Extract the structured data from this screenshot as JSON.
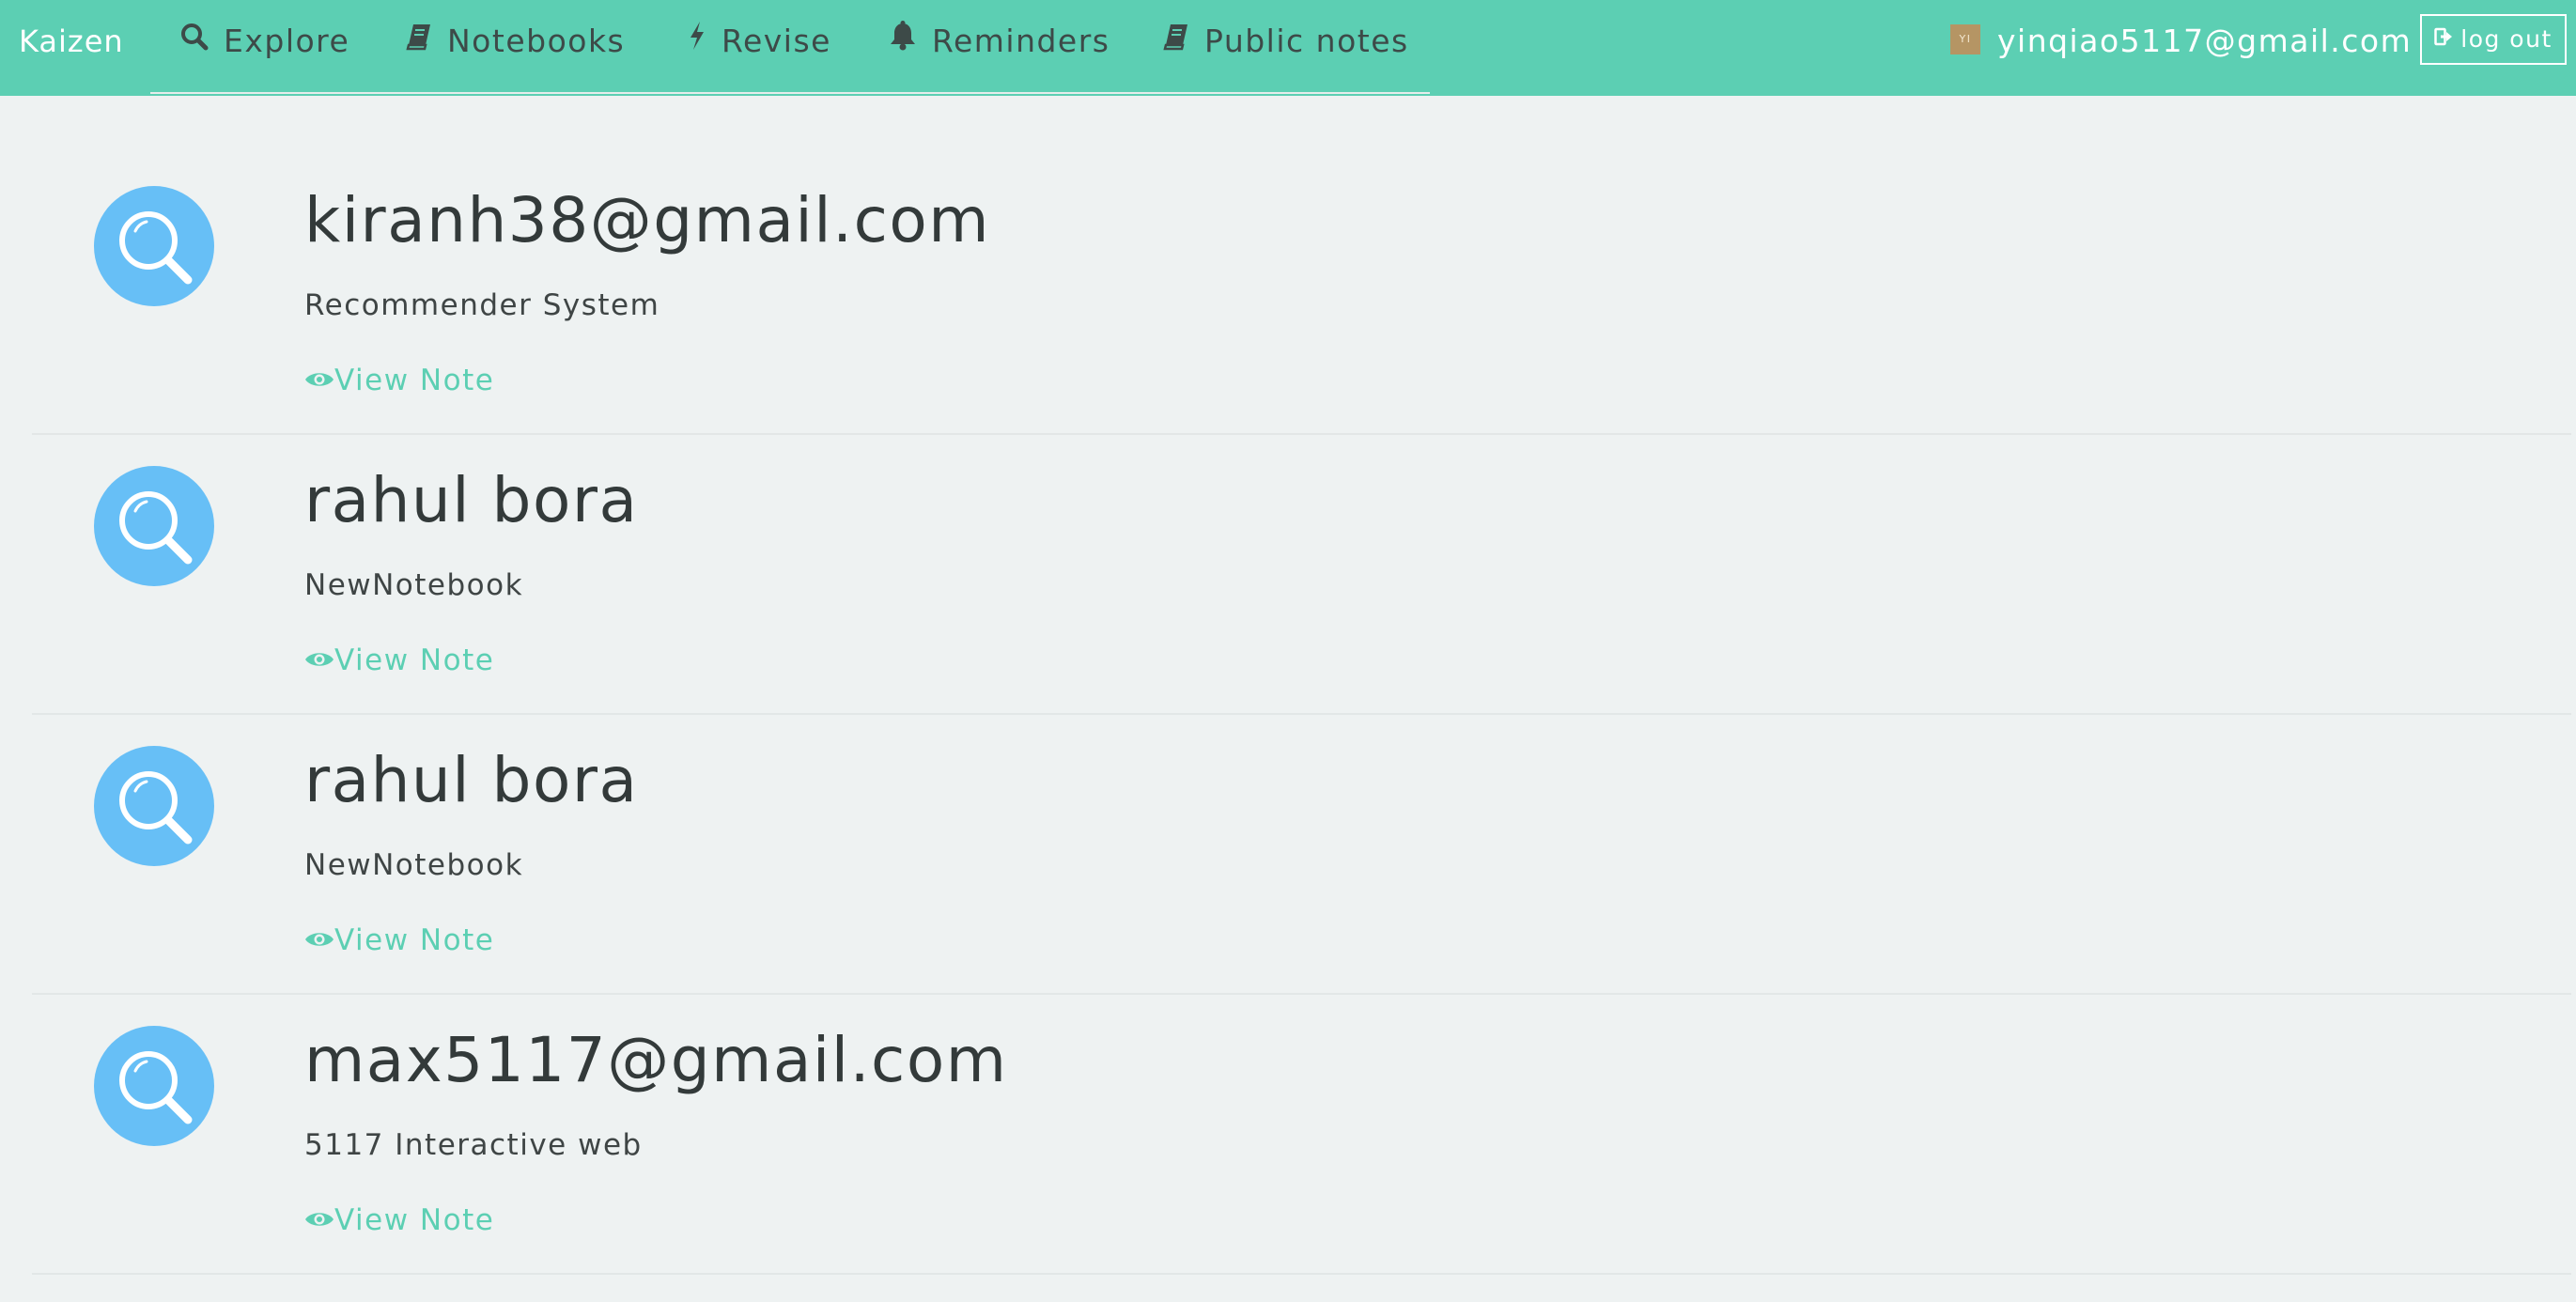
{
  "navbar": {
    "brand": "Kaizen",
    "items": [
      {
        "label": "Explore",
        "icon": "search-icon"
      },
      {
        "label": "Notebooks",
        "icon": "book-icon"
      },
      {
        "label": "Revise",
        "icon": "bolt-icon"
      },
      {
        "label": "Reminders",
        "icon": "bell-icon"
      },
      {
        "label": "Public notes",
        "icon": "book-icon"
      }
    ],
    "user": {
      "avatar_initials": "YI",
      "email": "yinqiao5117@gmail.com"
    },
    "logout_label": "log out"
  },
  "notes": [
    {
      "title": "kiranh38@gmail.com",
      "notebook": "Recommender System",
      "link_label": "View Note"
    },
    {
      "title": "rahul bora",
      "notebook": "NewNotebook",
      "link_label": "View Note"
    },
    {
      "title": "rahul bora",
      "notebook": "NewNotebook",
      "link_label": "View Note"
    },
    {
      "title": "max5117@gmail.com",
      "notebook": "5117 Interactive web",
      "link_label": "View Note"
    }
  ],
  "colors": {
    "navbar_bg": "#5ccfb3",
    "page_bg": "#eef2f2",
    "accent": "#5ccfb3",
    "thumb_bg": "#67bff6",
    "avatar_bg": "#b59564"
  }
}
